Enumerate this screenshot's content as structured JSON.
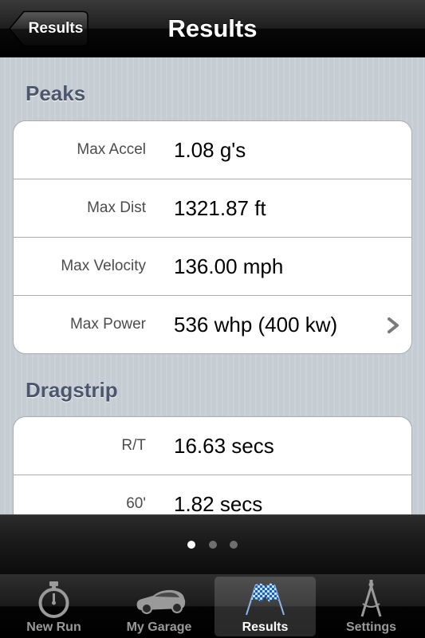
{
  "navbar": {
    "back_label": "Results",
    "title": "Results"
  },
  "sections": {
    "peaks": {
      "header": "Peaks",
      "rows": [
        {
          "label": "Max Accel",
          "value": "1.08 g's"
        },
        {
          "label": "Max Dist",
          "value": "1321.87 ft"
        },
        {
          "label": "Max Velocity",
          "value": "136.00 mph"
        },
        {
          "label": "Max Power",
          "value": "536 whp (400 kw)"
        }
      ]
    },
    "dragstrip": {
      "header": "Dragstrip",
      "rows": [
        {
          "label": "R/T",
          "value": "16.63 secs"
        },
        {
          "label": "60'",
          "value": "1.82 secs"
        }
      ]
    }
  },
  "pager": {
    "pages": 3,
    "current": 1
  },
  "tabbar": {
    "selected": "results",
    "tabs": [
      {
        "id": "new-run",
        "label": "New Run",
        "icon": "stopwatch-icon"
      },
      {
        "id": "my-garage",
        "label": "My Garage",
        "icon": "car-icon"
      },
      {
        "id": "results",
        "label": "Results",
        "icon": "checkered-flags-icon"
      },
      {
        "id": "settings",
        "label": "Settings",
        "icon": "compass-icon"
      }
    ]
  },
  "colors": {
    "section_header": "#4c566c",
    "background_stripe": "#c5ccd4",
    "tab_inactive": "#9a9a9a"
  }
}
